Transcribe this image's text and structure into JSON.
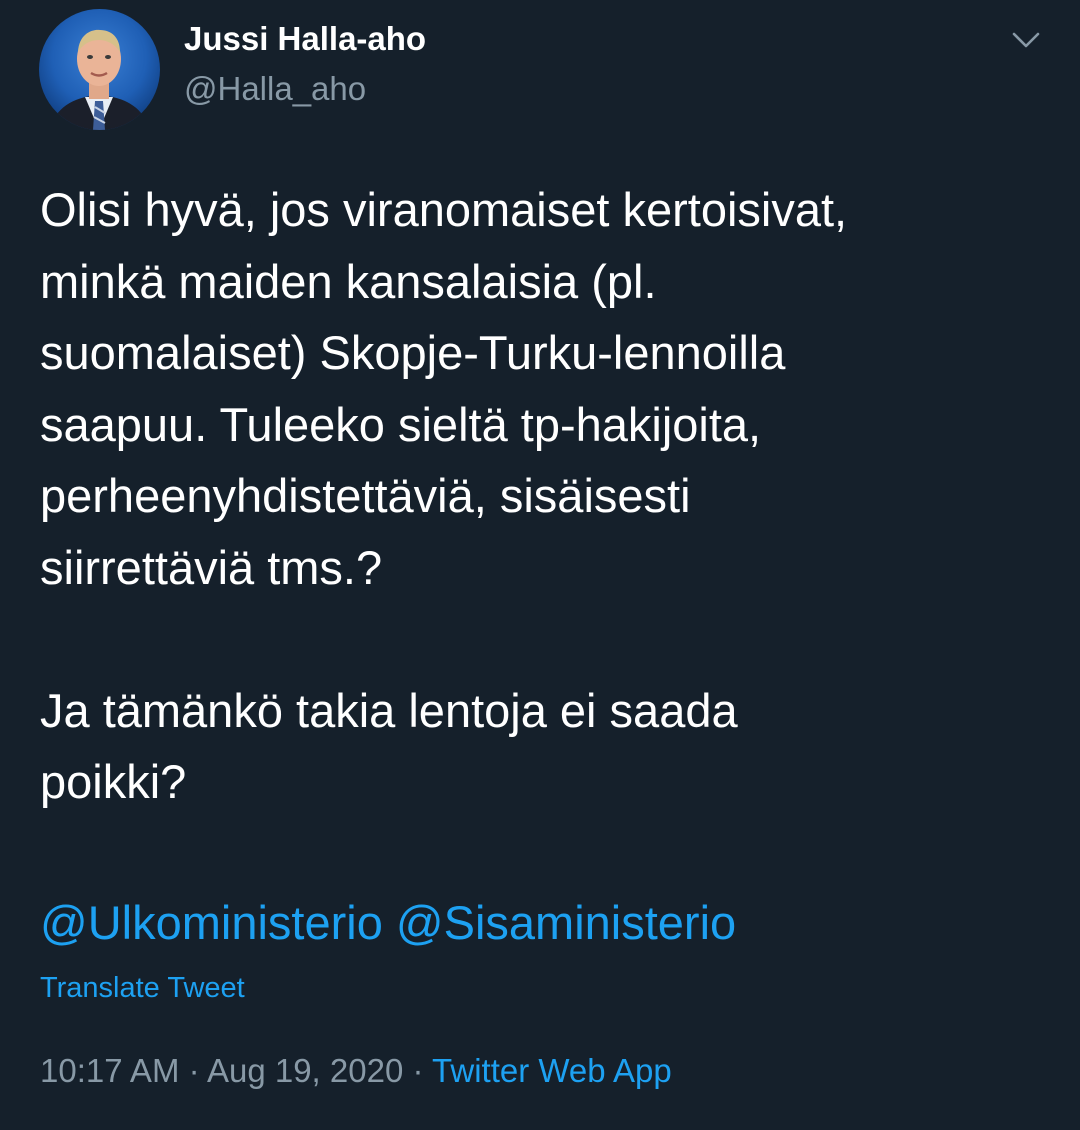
{
  "colors": {
    "background": "#15202b",
    "text": "#ffffff",
    "secondary_text": "#8899a6",
    "link": "#1da1f2"
  },
  "author": {
    "name": "Jussi Halla-aho",
    "handle": "@Halla_aho",
    "avatar_icon": "profile-photo"
  },
  "menu": {
    "icon": "chevron-down-icon"
  },
  "tweet": {
    "paragraph_1_lines": [
      "Olisi hyvä, jos viranomaiset kertoisivat,",
      "minkä maiden kansalaisia (pl.",
      "suomalaiset) Skopje-Turku-lennoilla",
      "saapuu. Tuleeko sieltä tp-hakijoita,",
      "perheenyhdistettäviä, sisäisesti",
      "siirrettäviä tms.?"
    ],
    "paragraph_2_lines": [
      "Ja tämänkö takia lentoja ei saada",
      "poikki?"
    ],
    "mentions": [
      "@Ulkoministerio",
      "@Sisaministerio"
    ]
  },
  "translate_label": "Translate Tweet",
  "meta": {
    "time": "10:17 AM",
    "separator": " · ",
    "date": "Aug 19, 2020",
    "source": "Twitter Web App"
  }
}
